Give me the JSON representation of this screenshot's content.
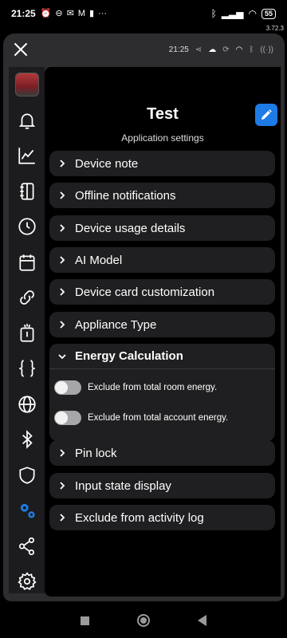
{
  "statusbar": {
    "time": "21:25",
    "left_icons": [
      "alarm-off-icon",
      "dnd-icon",
      "chat-icon",
      "gmail-icon",
      "clipboard-icon",
      "more-icon"
    ],
    "battery": "55"
  },
  "app_version": "3.72.3",
  "window_bar": {
    "time": "21:25"
  },
  "sidebar": {
    "items": [
      {
        "name": "device-thumbnail"
      },
      {
        "name": "notifications-icon"
      },
      {
        "name": "chart-icon"
      },
      {
        "name": "notebook-icon"
      },
      {
        "name": "clock-icon"
      },
      {
        "name": "calendar-icon"
      },
      {
        "name": "link-icon"
      },
      {
        "name": "action-icon"
      },
      {
        "name": "code-braces-icon"
      },
      {
        "name": "globe-icon"
      },
      {
        "name": "bluetooth-icon"
      },
      {
        "name": "shield-icon"
      },
      {
        "name": "gears-icon",
        "active": true
      },
      {
        "name": "share-icon"
      },
      {
        "name": "settings-icon"
      }
    ],
    "active_color": "#1e7be5"
  },
  "main": {
    "title": "Test",
    "subtitle": "Application settings",
    "sections": [
      {
        "label": "Device note"
      },
      {
        "label": "Offline notifications"
      },
      {
        "label": "Device usage details"
      },
      {
        "label": "AI Model"
      },
      {
        "label": "Device card customization"
      },
      {
        "label": "Appliance Type"
      }
    ],
    "open_section": {
      "label": "Energy Calculation",
      "toggles": [
        {
          "label": "Exclude from total room energy.",
          "on": false
        },
        {
          "label": "Exclude from total account energy.",
          "on": false
        }
      ]
    },
    "sections_after": [
      {
        "label": "Pin lock"
      },
      {
        "label": "Input state display"
      },
      {
        "label": "Exclude from activity log"
      }
    ]
  }
}
